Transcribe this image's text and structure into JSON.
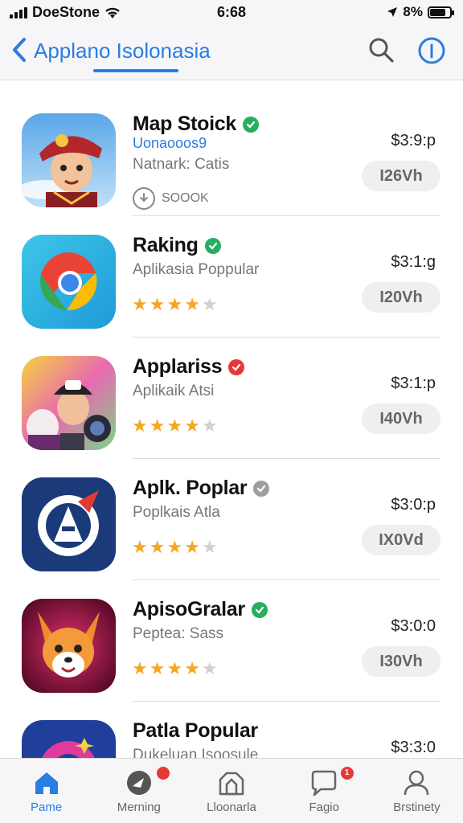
{
  "status_bar": {
    "carrier": "DoeStone",
    "time": "6:68",
    "battery": "8%",
    "battery_level": 0.8
  },
  "nav": {
    "title": "Applano Isolonasia",
    "back_icon": "chevron-left-icon",
    "search_icon": "search-icon",
    "info_icon": "info-icon",
    "accent": "#2a7de1"
  },
  "apps": [
    {
      "name": "Map Stoick",
      "badge_color": "#27ae60",
      "developer": "Uonaooos9",
      "subtitle": "Natnark: Catis",
      "install_label": "SOOOK",
      "price": "$3:9:p",
      "button": "I26Vh"
    },
    {
      "name": "Raking",
      "badge_color": "#27ae60",
      "subtitle": "Aplikasia Poppular",
      "rating": 4,
      "price": "$3:1:g",
      "button": "I20Vh"
    },
    {
      "name": "Applariss",
      "badge_color": "#e53935",
      "subtitle": "Aplikaik Atsi",
      "rating": 4,
      "price": "$3:1:p",
      "button": "I40Vh"
    },
    {
      "name": "Aplk. Poplar",
      "badge_color": "#9e9e9e",
      "subtitle": "Poplkais Atla",
      "rating": 4,
      "price": "$3:0:p",
      "button": "IX0Vd"
    },
    {
      "name": "ApisoGralar",
      "badge_color": "#27ae60",
      "subtitle": "Peptea: Sass",
      "rating": 4,
      "price": "$3:0:0",
      "button": "I30Vh"
    },
    {
      "name": "Patla Popular",
      "subtitle": "Dukeluan Isoosule",
      "price": "$3:3:0"
    }
  ],
  "tabs": [
    {
      "label": "Pame",
      "icon": "home-icon",
      "active": true
    },
    {
      "label": "Merning",
      "icon": "compass-icon",
      "active": false,
      "notification": true
    },
    {
      "label": "Lloonarla",
      "icon": "store-icon",
      "active": false
    },
    {
      "label": "Fagio",
      "icon": "chat-icon",
      "active": false,
      "notification_count": "1"
    },
    {
      "label": "Brstinety",
      "icon": "profile-icon",
      "active": false
    }
  ]
}
